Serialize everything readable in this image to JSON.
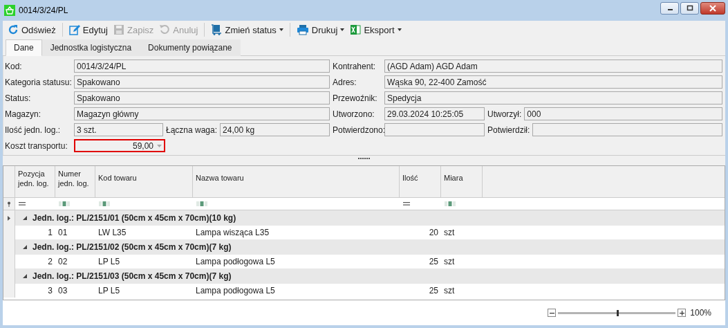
{
  "window": {
    "title": "0014/3/24/PL"
  },
  "toolbar": [
    [
      {
        "label": "Odśwież",
        "disabled": false,
        "dropdown": false
      }
    ],
    [
      {
        "label": "Edytuj",
        "disabled": false,
        "dropdown": false
      },
      {
        "label": "Zapisz",
        "disabled": true,
        "dropdown": false
      },
      {
        "label": "Anuluj",
        "disabled": true,
        "dropdown": false
      }
    ],
    [
      {
        "label": "Zmień status",
        "disabled": false,
        "dropdown": true
      }
    ],
    [
      {
        "label": "Drukuj",
        "disabled": false,
        "dropdown": true
      },
      {
        "label": "Eksport",
        "disabled": false,
        "dropdown": true
      }
    ]
  ],
  "tabs": [
    {
      "label": "Dane",
      "selected": true
    },
    {
      "label": "Jednostka logistyczna",
      "selected": false
    },
    {
      "label": "Dokumenty powiązane",
      "selected": false
    }
  ],
  "form": {
    "left": [
      {
        "fields": [
          {
            "label": "Kod:",
            "value": "0014/3/24/PL",
            "highlighted": false,
            "kind": "text"
          }
        ]
      },
      {
        "fields": [
          {
            "label": "Kategoria statusu:",
            "value": "Spakowano",
            "highlighted": false,
            "kind": "text"
          }
        ]
      },
      {
        "fields": [
          {
            "label": "Status:",
            "value": "Spakowano",
            "highlighted": false,
            "kind": "text"
          }
        ]
      },
      {
        "fields": [
          {
            "label": "Magazyn:",
            "value": "Magazyn główny",
            "highlighted": false,
            "kind": "text"
          }
        ]
      },
      {
        "fields": [
          {
            "label": "Ilość jedn. log.:",
            "value": "3 szt.",
            "highlighted": false,
            "kind": "text"
          },
          {
            "label": "Łączna waga:",
            "value": "24,00 kg",
            "highlighted": false,
            "kind": "text"
          }
        ]
      },
      {
        "fields": [
          {
            "label": "Koszt transportu:",
            "value": "59,00",
            "highlighted": true,
            "kind": "amount"
          }
        ]
      }
    ],
    "right": [
      {
        "fields": [
          {
            "label": "Kontrahent:",
            "value": "(AGD Adam) AGD Adam",
            "highlighted": false,
            "kind": "text"
          }
        ]
      },
      {
        "fields": [
          {
            "label": "Adres:",
            "value": "Wąska 90, 22-400 Zamość",
            "highlighted": false,
            "kind": "text"
          }
        ]
      },
      {
        "fields": [
          {
            "label": "Przewoźnik:",
            "value": "Spedycja",
            "highlighted": false,
            "kind": "text"
          }
        ]
      },
      {
        "fields": [
          {
            "label": "Utworzono:",
            "value": "29.03.2024 10:25:05",
            "highlighted": false,
            "kind": "text"
          },
          {
            "label": "Utworzył:",
            "value": "000",
            "highlighted": false,
            "kind": "text"
          }
        ]
      },
      {
        "fields": [
          {
            "label": "Potwierdzono:",
            "highlighted": false,
            "kind": "text"
          },
          {
            "label": "Potwierdził:",
            "highlighted": false,
            "kind": "text"
          }
        ]
      }
    ]
  },
  "grid": {
    "columns": [
      {
        "label": "Pozycja jedn. log.",
        "kind": "number"
      },
      {
        "label": "Numer jedn. log.",
        "kind": "text"
      },
      {
        "label": "Kod towaru",
        "kind": "text"
      },
      {
        "label": "Nazwa towaru",
        "kind": "text"
      },
      {
        "label": "Ilość",
        "kind": "number"
      },
      {
        "label": "Miara",
        "kind": "text"
      }
    ],
    "groups": [
      {
        "label": "Jedn. log.: PL/2151/01 (50cm x 45cm x 70cm)(10 kg)",
        "expanded": true,
        "current": true,
        "rows": [
          [
            "1",
            "01",
            "LW L35",
            "Lampa wisząca L35",
            "20",
            "szt"
          ]
        ]
      },
      {
        "label": "Jedn. log.: PL/2151/02 (50cm x 45cm x 70cm)(7 kg)",
        "expanded": true,
        "current": false,
        "rows": [
          [
            "2",
            "02",
            "LP L5",
            "Lampa podłogowa L5",
            "25",
            "szt"
          ]
        ]
      },
      {
        "label": "Jedn. log.: PL/2151/03 (50cm x 45cm x 70cm)(7 kg)",
        "expanded": true,
        "current": false,
        "rows": [
          [
            "3",
            "03",
            "LP L5",
            "Lampa podłogowa L5",
            "25",
            "szt"
          ]
        ]
      }
    ]
  },
  "zoom": {
    "level": 0.5,
    "reading": "100%"
  }
}
